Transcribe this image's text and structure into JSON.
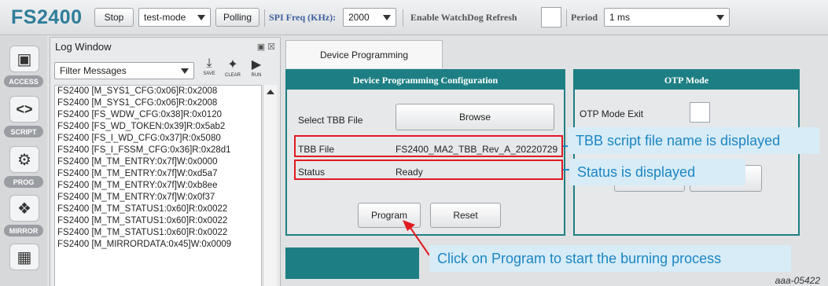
{
  "toolbar": {
    "brand": "FS2400",
    "stop_label": "Stop",
    "mode_value": "test-mode",
    "polling_label": "Polling",
    "spi_label": "SPI Freq (KHz):",
    "spi_value": "2000",
    "watchdog_label": "Enable WatchDog Refresh",
    "period_label": "Period",
    "period_value": "1 ms"
  },
  "rail": {
    "items": [
      {
        "label": "ACCESS",
        "icon": "chip-icon"
      },
      {
        "label": "SCRIPT",
        "icon": "code-icon"
      },
      {
        "label": "PROG",
        "icon": "prog-gear-icon"
      },
      {
        "label": "MIRROR",
        "icon": "mirror-icon"
      },
      {
        "label": "",
        "icon": "calculator-icon"
      }
    ]
  },
  "log": {
    "title": "Log Window",
    "window_icons": "▣ ☒",
    "filter_value": "Filter Messages",
    "tools": {
      "save": "SAVE",
      "clear": "CLEAR",
      "run": "RUN"
    },
    "lines": [
      "FS2400 [M_SYS1_CFG:0x06]R:0x2008",
      "FS2400 [M_SYS1_CFG:0x06]R:0x2008",
      "FS2400 [FS_WDW_CFG:0x38]R:0x0120",
      "FS2400 [FS_WD_TOKEN:0x39]R:0x5ab2",
      "FS2400 [FS_I_WD_CFG:0x37]R:0x5080",
      "FS2400 [FS_I_FSSM_CFG:0x36]R:0x28d1",
      "FS2400 [M_TM_ENTRY:0x7f]W:0x0000",
      "FS2400 [M_TM_ENTRY:0x7f]W:0xd5a7",
      "FS2400 [M_TM_ENTRY:0x7f]W:0xb8ee",
      "FS2400 [M_TM_ENTRY:0x7f]W:0x0f37",
      "FS2400 [M_TM_STATUS1:0x60]R:0x0022",
      "FS2400 [M_TM_STATUS1:0x60]R:0x0022",
      "FS2400 [M_TM_STATUS1:0x60]R:0x0022",
      "FS2400 [M_MIRRORDATA:0x45]W:0x0009"
    ]
  },
  "main": {
    "tab_label": "Device Programming",
    "config": {
      "title": "Device Programming Configuration",
      "select_tbb_label": "Select TBB File",
      "browse_label": "Browse",
      "tbb_file_label": "TBB File",
      "tbb_file_value": "FS2400_MA2_TBB_Rev_A_20220729",
      "status_label": "Status",
      "status_value": "Ready",
      "program_label": "Program",
      "reset_label": "Reset"
    },
    "otp": {
      "title": "OTP Mode",
      "exit_label": "OTP Mode Exit"
    }
  },
  "annotations": {
    "tbb_callout": "TBB script file name is displayed",
    "status_callout": "Status is displayed",
    "program_callout": "Click on Program to start the burning process",
    "figure_id": "aaa-05422"
  },
  "colors": {
    "brand": "#2e7d9a",
    "panel_header": "#1d7f84",
    "highlight_red": "#e01b22",
    "callout_bg": "#d7ecf7",
    "callout_text": "#1d86c2"
  }
}
